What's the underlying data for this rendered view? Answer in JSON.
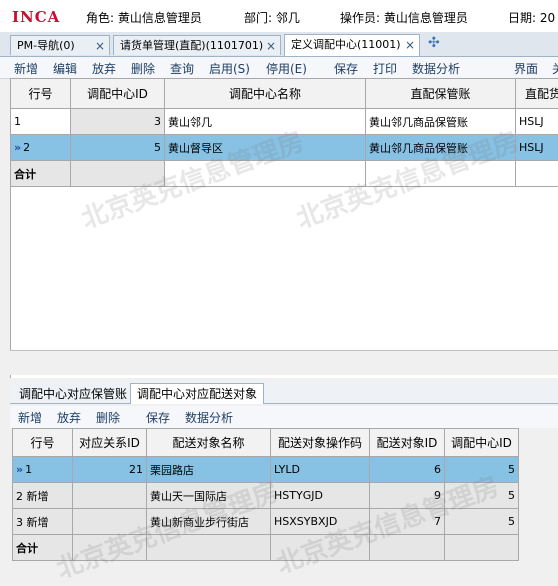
{
  "header": {
    "logo": "INCA",
    "role": "角色: 黄山信息管理员",
    "dept": "部门: 邻几",
    "operator": "操作员: 黄山信息管理员",
    "date": "日期: 20"
  },
  "tabs": [
    {
      "label": "PM-导航(0)",
      "close": "×"
    },
    {
      "label": "请货单管理(直配)(1101701)",
      "close": "×"
    },
    {
      "label": "定义调配中心(11001)",
      "close": "×"
    }
  ],
  "tab_add": "✣",
  "toolbar": [
    "新增",
    "编辑",
    "放弃",
    "删除",
    "查询",
    "启用(S)",
    "停用(E)",
    "保存",
    "打印",
    "数据分析",
    "界面",
    "关"
  ],
  "main_table": {
    "headers": [
      "行号",
      "调配中心ID",
      "调配中心名称",
      "直配保管账",
      "直配货"
    ],
    "rows": [
      {
        "no": "1",
        "id": "3",
        "name": "黄山邻几",
        "acct": "黄山邻几商品保管账",
        "code": "HSLJ"
      },
      {
        "no": "2",
        "id": "5",
        "name": "黄山督导区",
        "acct": "黄山邻几商品保管账",
        "code": "HSLJ"
      }
    ],
    "total_label": "合计"
  },
  "subtabs": [
    "调配中心对应保管账",
    "调配中心对应配送对象"
  ],
  "subtoolbar": [
    "新增",
    "放弃",
    "删除",
    "保存",
    "数据分析"
  ],
  "sub_table": {
    "headers": [
      "行号",
      "对应关系ID",
      "配送对象名称",
      "配送对象操作码",
      "配送对象ID",
      "调配中心ID"
    ],
    "rows": [
      {
        "no": "1",
        "rid": "21",
        "name": "栗园路店",
        "code": "LYLD",
        "oid": "6",
        "cid": "5"
      },
      {
        "no": "2 新增",
        "rid": "",
        "name": "黄山天一国际店",
        "code": "HSTYGJD",
        "oid": "9",
        "cid": "5"
      },
      {
        "no": "3 新增",
        "rid": "",
        "name": "黄山新商业步行街店",
        "code": "HSXSYBXJD",
        "oid": "7",
        "cid": "5"
      }
    ],
    "total_label": "合计"
  },
  "watermark": "北京英克信息管理房",
  "colors": {
    "logo": "#c8102e",
    "selected_row": "#87c1e3",
    "accent": "#1f3f66"
  }
}
